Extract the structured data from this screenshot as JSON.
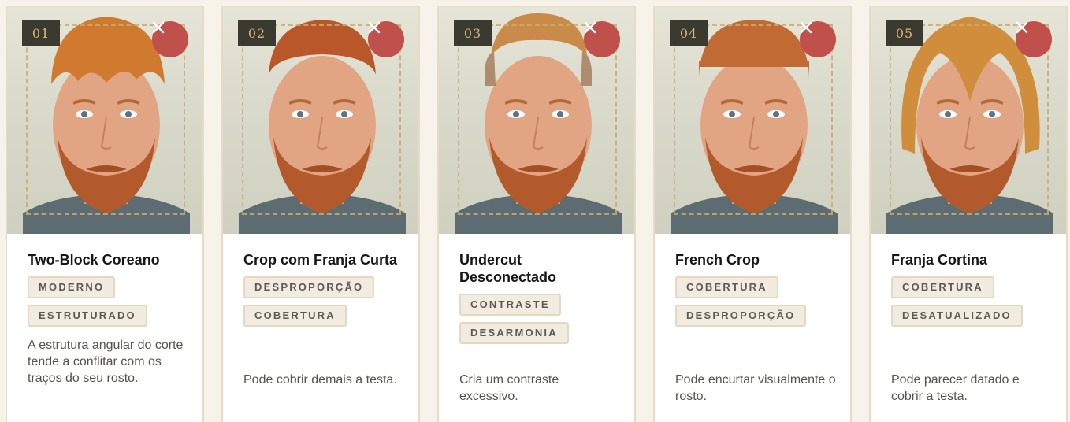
{
  "colors": {
    "page_bg": "#f7f3ea",
    "card_border": "#e6dcc6",
    "close_button": "#c0504b",
    "number_badge_bg": "#3b3a30",
    "number_badge_text": "#d6b77a",
    "tag_bg": "#f2ebdf"
  },
  "cards": [
    {
      "number": "01",
      "title": "Two-Block Coreano",
      "tags": [
        "MODERNO",
        "ESTRUTURADO"
      ],
      "description": "A estrutura angular do corte tende a conflitar com os traços do seu rosto.",
      "close_icon": "close-icon",
      "hair_style": "two-block"
    },
    {
      "number": "02",
      "title": "Crop com Franja Curta",
      "tags": [
        "DESPROPORÇÃO",
        "COBERTURA"
      ],
      "description": "Pode cobrir demais a testa.",
      "close_icon": "close-icon",
      "hair_style": "crop"
    },
    {
      "number": "03",
      "title": "Undercut Desconectado",
      "tags": [
        "CONTRASTE",
        "DESARMONIA"
      ],
      "description": "Cria um contraste excessivo.",
      "close_icon": "close-icon",
      "hair_style": "undercut"
    },
    {
      "number": "04",
      "title": "French Crop",
      "tags": [
        "COBERTURA",
        "DESPROPORÇÃO"
      ],
      "description": "Pode encurtar visualmente o rosto.",
      "close_icon": "close-icon",
      "hair_style": "french-crop"
    },
    {
      "number": "05",
      "title": "Franja Cortina",
      "tags": [
        "COBERTURA",
        "DESATUALIZADO"
      ],
      "description": "Pode parecer datado e cobrir a testa.",
      "close_icon": "close-icon",
      "hair_style": "curtain"
    }
  ]
}
